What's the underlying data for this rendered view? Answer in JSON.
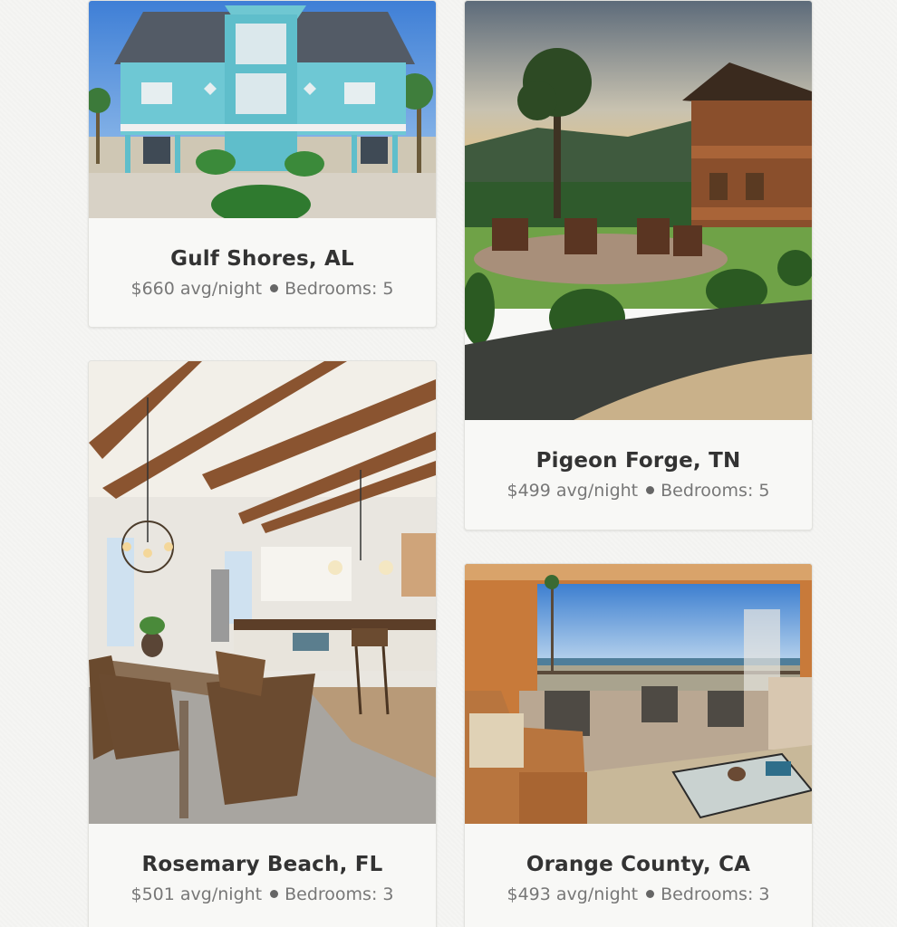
{
  "listings": [
    {
      "location": "Gulf Shores, AL",
      "price": "$660 avg/night",
      "bedrooms": "Bedrooms: 5",
      "image": "blue beach house on stilts"
    },
    {
      "location": "Pigeon Forge, TN",
      "price": "$499 avg/night",
      "bedrooms": "Bedrooms: 5",
      "image": "log cabin with fire pit and adirondack chairs"
    },
    {
      "location": "Rosemary Beach, FL",
      "price": "$501 avg/night",
      "bedrooms": "Bedrooms: 3",
      "image": "dining room with wooden ceiling beams"
    },
    {
      "location": "Orange County, CA",
      "price": "$493 avg/night",
      "bedrooms": "Bedrooms: 3",
      "image": "living room opening to ocean view patio"
    }
  ],
  "colors": {
    "title": "#333333",
    "meta": "#777777",
    "card_bg": "#f8f8f6",
    "page_bg": "#f5f5f3"
  }
}
